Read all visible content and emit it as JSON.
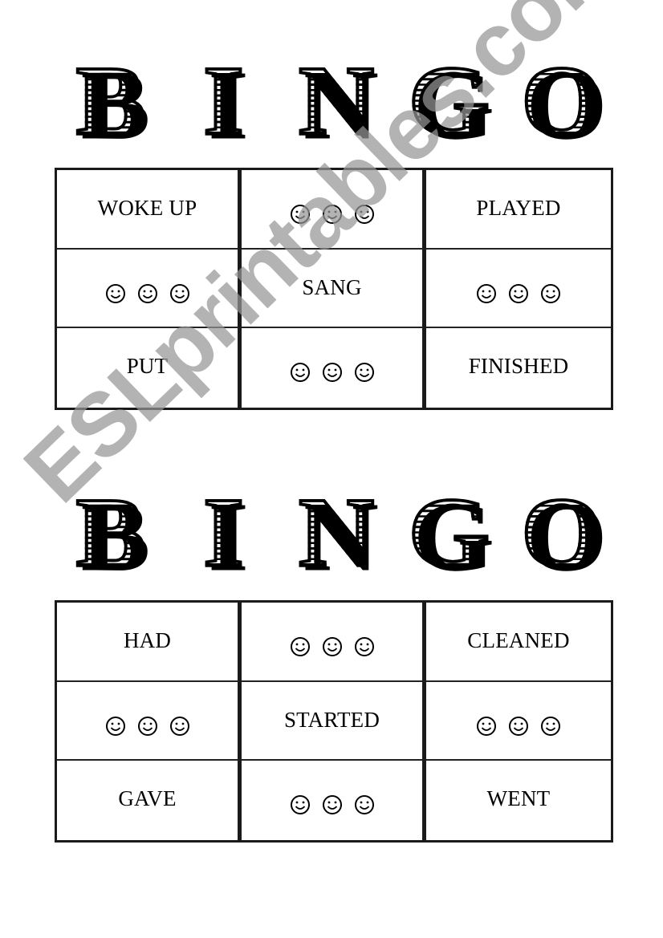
{
  "cards": [
    {
      "title_letters": [
        "B",
        "I",
        "N",
        "G",
        "O"
      ],
      "cells": [
        {
          "type": "text",
          "text": "WOKE UP"
        },
        {
          "type": "smileys",
          "count": 3,
          "icon": "smiley-face-icon"
        },
        {
          "type": "text",
          "text": "PLAYED"
        },
        {
          "type": "smileys",
          "count": 3,
          "icon": "smiley-face-icon"
        },
        {
          "type": "text",
          "text": "SANG"
        },
        {
          "type": "smileys",
          "count": 3,
          "icon": "smiley-face-icon"
        },
        {
          "type": "text",
          "text": "PUT"
        },
        {
          "type": "smileys",
          "count": 3,
          "icon": "smiley-face-icon"
        },
        {
          "type": "text",
          "text": "FINISHED"
        }
      ]
    },
    {
      "title_letters": [
        "B",
        "I",
        "N",
        "G",
        "O"
      ],
      "cells": [
        {
          "type": "text",
          "text": "HAD"
        },
        {
          "type": "smileys",
          "count": 3,
          "icon": "smiley-face-icon"
        },
        {
          "type": "text",
          "text": "CLEANED"
        },
        {
          "type": "smileys",
          "count": 3,
          "icon": "smiley-face-icon"
        },
        {
          "type": "text",
          "text": "STARTED"
        },
        {
          "type": "smileys",
          "count": 3,
          "icon": "smiley-face-icon"
        },
        {
          "type": "text",
          "text": "GAVE"
        },
        {
          "type": "smileys",
          "count": 3,
          "icon": "smiley-face-icon"
        },
        {
          "type": "text",
          "text": "WENT"
        }
      ]
    }
  ],
  "watermark": "ESLprintables.com"
}
